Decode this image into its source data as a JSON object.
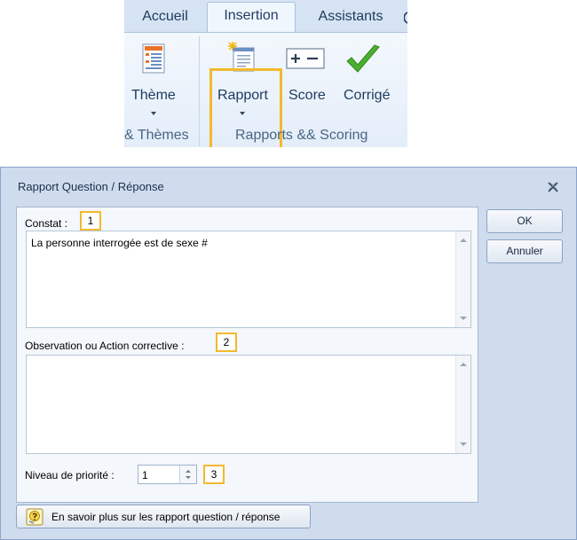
{
  "ribbon": {
    "tabs": [
      "Accueil",
      "Insertion",
      "Assistants"
    ],
    "buttons": {
      "theme": "Thème",
      "rapport": "Rapport",
      "score": "Score",
      "corrige": "Corrigé"
    },
    "groups": {
      "themes": "& Thèmes",
      "rapports": "Rapports && Scoring"
    },
    "highlight_color": "#f3b92d"
  },
  "dialog": {
    "title": "Rapport Question / Réponse",
    "constat_label": "Constat :",
    "constat_value": "La personne interrogée est de sexe #",
    "observation_label": "Observation ou Action corrective :",
    "observation_value": "",
    "priority_label": "Niveau de priorité :",
    "priority_value": "1",
    "ok_label": "OK",
    "cancel_label": "Annuler",
    "help_label": "En savoir plus sur les rapport question / réponse",
    "callouts": [
      "1",
      "2",
      "3"
    ],
    "background": "#cfdcee"
  }
}
